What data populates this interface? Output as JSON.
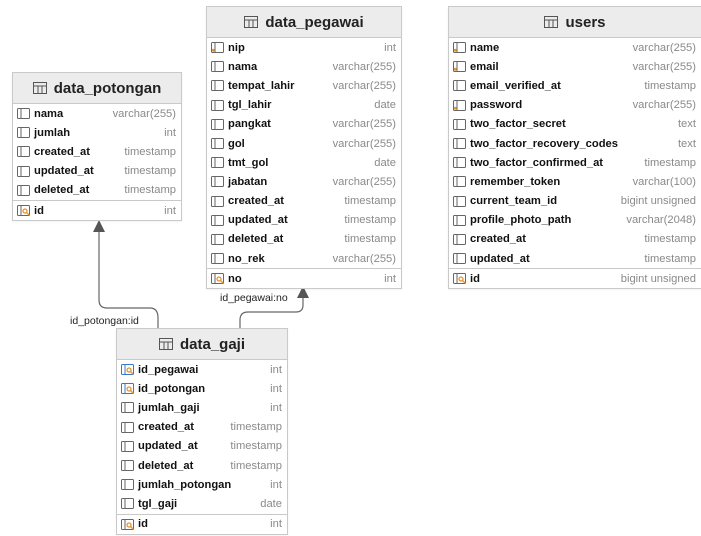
{
  "tables": {
    "data_pegawai": {
      "name": "data_pegawai",
      "fields": [
        {
          "name": "nip",
          "type": "int",
          "icon": "key-column-icon"
        },
        {
          "name": "nama",
          "type": "varchar(255)",
          "icon": "column-icon"
        },
        {
          "name": "tempat_lahir",
          "type": "varchar(255)",
          "icon": "column-icon"
        },
        {
          "name": "tgl_lahir",
          "type": "date",
          "icon": "column-icon"
        },
        {
          "name": "pangkat",
          "type": "varchar(255)",
          "icon": "column-icon"
        },
        {
          "name": "gol",
          "type": "varchar(255)",
          "icon": "column-icon"
        },
        {
          "name": "tmt_gol",
          "type": "date",
          "icon": "column-icon"
        },
        {
          "name": "jabatan",
          "type": "varchar(255)",
          "icon": "column-icon"
        },
        {
          "name": "created_at",
          "type": "timestamp",
          "icon": "column-icon"
        },
        {
          "name": "updated_at",
          "type": "timestamp",
          "icon": "column-icon"
        },
        {
          "name": "deleted_at",
          "type": "timestamp",
          "icon": "column-icon"
        },
        {
          "name": "no_rek",
          "type": "varchar(255)",
          "icon": "column-icon"
        }
      ],
      "pk": {
        "name": "no",
        "type": "int",
        "icon": "primary-key-icon"
      }
    },
    "users": {
      "name": "users",
      "fields": [
        {
          "name": "name",
          "type": "varchar(255)",
          "icon": "key-column-icon"
        },
        {
          "name": "email",
          "type": "varchar(255)",
          "icon": "key-column-icon"
        },
        {
          "name": "email_verified_at",
          "type": "timestamp",
          "icon": "column-icon"
        },
        {
          "name": "password",
          "type": "varchar(255)",
          "icon": "key-column-icon"
        },
        {
          "name": "two_factor_secret",
          "type": "text",
          "icon": "column-icon"
        },
        {
          "name": "two_factor_recovery_codes",
          "type": "text",
          "icon": "column-icon"
        },
        {
          "name": "two_factor_confirmed_at",
          "type": "timestamp",
          "icon": "column-icon"
        },
        {
          "name": "remember_token",
          "type": "varchar(100)",
          "icon": "column-icon"
        },
        {
          "name": "current_team_id",
          "type": "bigint unsigned",
          "icon": "column-icon"
        },
        {
          "name": "profile_photo_path",
          "type": "varchar(2048)",
          "icon": "column-icon"
        },
        {
          "name": "created_at",
          "type": "timestamp",
          "icon": "column-icon"
        },
        {
          "name": "updated_at",
          "type": "timestamp",
          "icon": "column-icon"
        }
      ],
      "pk": {
        "name": "id",
        "type": "bigint unsigned",
        "icon": "primary-key-icon"
      }
    },
    "data_potongan": {
      "name": "data_potongan",
      "fields": [
        {
          "name": "nama",
          "type": "varchar(255)",
          "icon": "column-icon"
        },
        {
          "name": "jumlah",
          "type": "int",
          "icon": "column-icon"
        },
        {
          "name": "created_at",
          "type": "timestamp",
          "icon": "column-icon"
        },
        {
          "name": "updated_at",
          "type": "timestamp",
          "icon": "column-icon"
        },
        {
          "name": "deleted_at",
          "type": "timestamp",
          "icon": "column-icon"
        }
      ],
      "pk": {
        "name": "id",
        "type": "int",
        "icon": "primary-key-icon"
      }
    },
    "data_gaji": {
      "name": "data_gaji",
      "fields": [
        {
          "name": "id_pegawai",
          "type": "int",
          "icon": "foreign-key-icon"
        },
        {
          "name": "id_potongan",
          "type": "int",
          "icon": "foreign-key-icon"
        },
        {
          "name": "jumlah_gaji",
          "type": "int",
          "icon": "column-icon"
        },
        {
          "name": "created_at",
          "type": "timestamp",
          "icon": "column-icon"
        },
        {
          "name": "updated_at",
          "type": "timestamp",
          "icon": "column-icon"
        },
        {
          "name": "deleted_at",
          "type": "timestamp",
          "icon": "column-icon"
        },
        {
          "name": "jumlah_potongan",
          "type": "int",
          "icon": "column-icon"
        },
        {
          "name": "tgl_gaji",
          "type": "date",
          "icon": "column-icon"
        }
      ],
      "pk": {
        "name": "id",
        "type": "int",
        "icon": "primary-key-icon"
      }
    }
  },
  "relations": [
    {
      "label": "id_pegawai:no",
      "from": "data_gaji",
      "to": "data_pegawai"
    },
    {
      "label": "id_potongan:id",
      "from": "data_gaji",
      "to": "data_potongan"
    }
  ],
  "colors": {
    "key_orange": "#e8912d",
    "fk_blue": "#3a78c9",
    "border": "#c9c9c9",
    "header_bg": "#ececec",
    "type_gray": "#8a8a8a"
  }
}
